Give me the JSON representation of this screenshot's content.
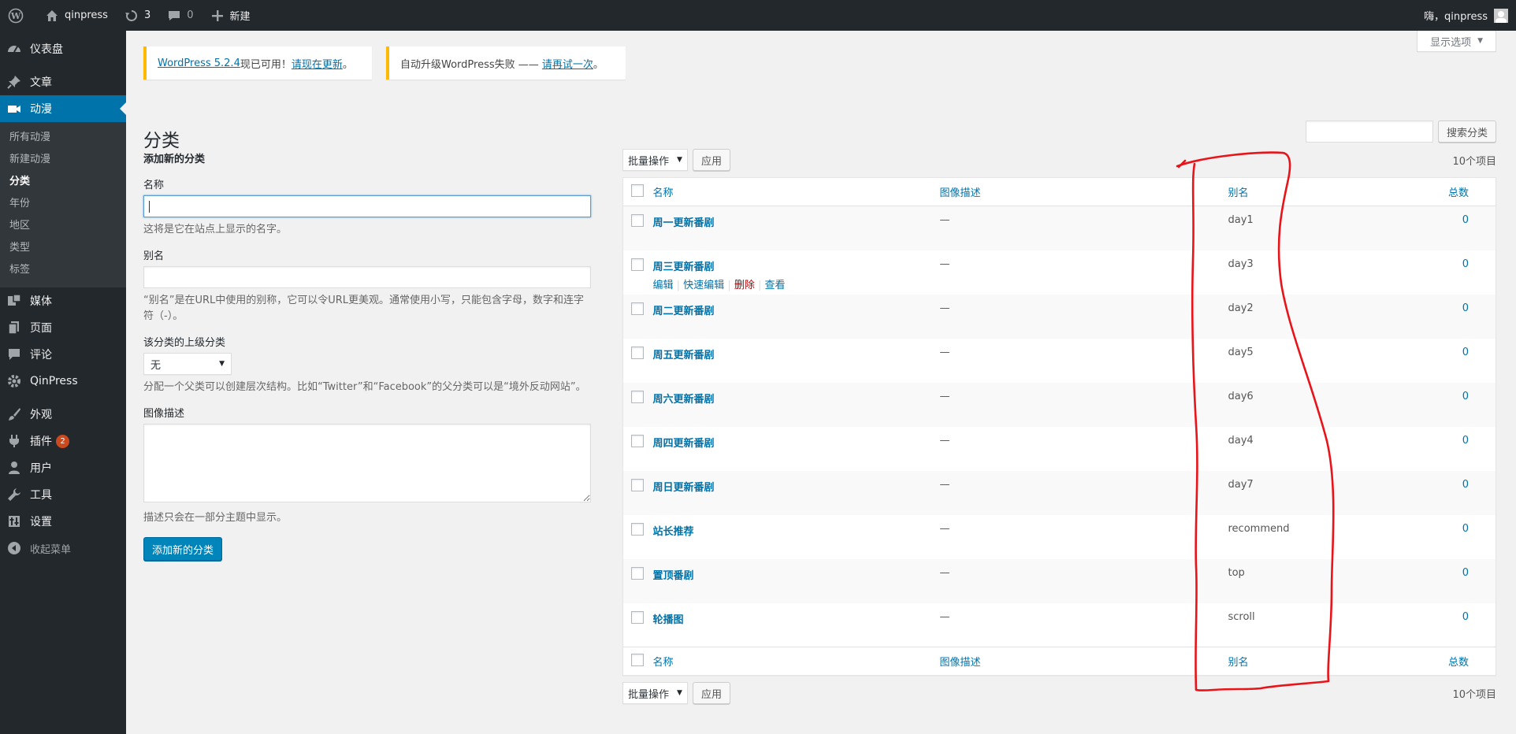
{
  "adminbar": {
    "site_name": "qinpress",
    "updates_count": "3",
    "comments_count": "0",
    "new_label": "新建",
    "greeting": "嗨，qinpress"
  },
  "sidebar": {
    "items": [
      {
        "label": "仪表盘",
        "icon": "dashboard-icon"
      },
      {
        "label": "文章",
        "icon": "pin-icon"
      },
      {
        "label": "动漫",
        "icon": "video-icon"
      },
      {
        "label": "媒体",
        "icon": "media-icon"
      },
      {
        "label": "页面",
        "icon": "page-icon"
      },
      {
        "label": "评论",
        "icon": "comment-icon"
      },
      {
        "label": "QinPress",
        "icon": "gear-icon"
      },
      {
        "label": "外观",
        "icon": "brush-icon"
      },
      {
        "label": "插件",
        "icon": "plugin-icon",
        "badge": "2"
      },
      {
        "label": "用户",
        "icon": "user-icon"
      },
      {
        "label": "工具",
        "icon": "wrench-icon"
      },
      {
        "label": "设置",
        "icon": "settings-icon"
      },
      {
        "label": "收起菜单",
        "icon": "collapse-icon"
      }
    ],
    "submenu": [
      "所有动漫",
      "新建动漫",
      "分类",
      "年份",
      "地区",
      "类型",
      "标签"
    ]
  },
  "screen_options": "显示选项",
  "notices": {
    "update_link": "WordPress 5.2.4",
    "update_text": "现已可用！",
    "update_now": "请现在更新",
    "update_end": "。",
    "auto_fail_text": "自动升级WordPress失败 —— ",
    "retry_link": "请再试一次",
    "retry_end": "。"
  },
  "page_title": "分类",
  "search": {
    "button": "搜索分类"
  },
  "form": {
    "heading": "添加新的分类",
    "name_label": "名称",
    "name_help": "这将是它在站点上显示的名字。",
    "slug_label": "别名",
    "slug_help": "“别名”是在URL中使用的别称，它可以令URL更美观。通常使用小写，只能包含字母，数字和连字符（-）。",
    "parent_label": "该分类的上级分类",
    "parent_value": "无",
    "parent_help": "分配一个父类可以创建层次结构。比如“Twitter”和“Facebook”的父分类可以是“境外反动网站”。",
    "desc_label": "图像描述",
    "desc_help": "描述只会在一部分主题中显示。",
    "submit": "添加新的分类"
  },
  "table": {
    "bulk_label": "批量操作",
    "apply": "应用",
    "count": "10个项目",
    "headers": {
      "name": "名称",
      "desc": "图像描述",
      "slug": "别名",
      "count": "总数"
    },
    "rows": [
      {
        "name": "周一更新番剧",
        "desc": "—",
        "slug": "day1",
        "count": "0"
      },
      {
        "name": "周三更新番剧",
        "desc": "—",
        "slug": "day3",
        "count": "0"
      },
      {
        "name": "周二更新番剧",
        "desc": "—",
        "slug": "day2",
        "count": "0"
      },
      {
        "name": "周五更新番剧",
        "desc": "—",
        "slug": "day5",
        "count": "0"
      },
      {
        "name": "周六更新番剧",
        "desc": "—",
        "slug": "day6",
        "count": "0"
      },
      {
        "name": "周四更新番剧",
        "desc": "—",
        "slug": "day4",
        "count": "0"
      },
      {
        "name": "周日更新番剧",
        "desc": "—",
        "slug": "day7",
        "count": "0"
      },
      {
        "name": "站长推荐",
        "desc": "—",
        "slug": "recommend",
        "count": "0"
      },
      {
        "name": "置顶番剧",
        "desc": "—",
        "slug": "top",
        "count": "0"
      },
      {
        "name": "轮播图",
        "desc": "—",
        "slug": "scroll",
        "count": "0"
      }
    ],
    "row_actions": {
      "edit": "编辑",
      "quick_edit": "快速编辑",
      "delete": "删除",
      "view": "查看"
    }
  },
  "colors": {
    "accent": "#0073aa",
    "annotation": "#e8141a",
    "notice_warning": "#ffb900"
  }
}
